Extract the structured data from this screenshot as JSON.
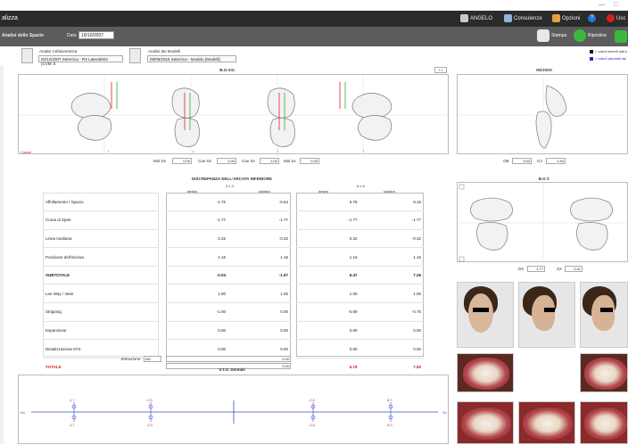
{
  "window": {
    "title": "alizza",
    "min": "—",
    "max": "□"
  },
  "topbar": {
    "user": "ANGELO",
    "consult": "Consulenze",
    "options": "Opzioni",
    "help": "?",
    "exit": "Usc"
  },
  "toolbar": {
    "analysis_label": "Analisi dello Spazio",
    "date_label": "Data",
    "date_value": "19/10/2007",
    "print": "Stampa",
    "reset": "Ripristina"
  },
  "selectors": {
    "ceph_label": "Analisi Cefalometrica",
    "ceph_value": "02/12/2007 Seterrica - RX LateraleDx (CVM: 5",
    "model_label": "Analisi dei Modelli",
    "model_value": "09/05/2016 Seterrica - Modelo (Modelli)"
  },
  "legend": {
    "manual": "= valori inseriti dall'u",
    "computed": "= valori calcolati dal",
    "manual_color": "#111111",
    "computed_color": "#1e2fd0"
  },
  "bovd": {
    "title": "B.O.V.D.",
    "add_btn": "+-+",
    "side_label": "Classe",
    "inputs": [
      {
        "label": "Mol Dx",
        "value": "0.00"
      },
      {
        "label": "Can Dx",
        "value": "2.00"
      },
      {
        "label": "Can Sx",
        "value": "2.00"
      },
      {
        "label": "Mol Sx",
        "value": "0.00"
      }
    ]
  },
  "incisivi": {
    "title": "INCISIVI",
    "ob_label": "OB",
    "ob_value": "3.53",
    "oj_label": "OJ",
    "oj_value": "1.54"
  },
  "bot": {
    "title": "B.O.T.",
    "dx_label": "DX",
    "dx_value": "1.77",
    "sx_label": "SX",
    "sx_value": "0.41"
  },
  "discrepanza": {
    "title": "DISCREPANZA DELL'ARCATA INFERIORE",
    "group1": "3 x 3",
    "group2": "6 x 6",
    "col_dx": "destra",
    "col_sx": "sinistra",
    "rows": [
      {
        "label": "Affollamento / Spazio",
        "a": "-1.75",
        "b": "-0.64",
        "c": "6.76",
        "d": "8.15",
        "style": ""
      },
      {
        "label": "Curva di Spee",
        "a": "-1.77",
        "b": "-1.77",
        "c": "-1.77",
        "d": "-1.77",
        "style": ""
      },
      {
        "label": "Linea mediana",
        "a": "0.32",
        "b": "-0.32",
        "c": "0.32",
        "d": "-0.32",
        "style": ""
      },
      {
        "label": "Posizione dell'incisivo",
        "a": "1.16",
        "b": "1.16",
        "c": "1.16",
        "d": "1.16",
        "style": ""
      },
      {
        "label": "SUBTOTALE",
        "a": "-2.04",
        "b": "-1.57",
        "c": "6.47",
        "d": "7.26",
        "style": "bold"
      },
      {
        "label": "Lee Way / Varie",
        "a": "1.00",
        "b": "1.00",
        "c": "1.00",
        "d": "1.00",
        "style": ""
      },
      {
        "label": "Stripping",
        "a": "-1.00",
        "b": "0.00",
        "c": "-0.69",
        "d": "-0.76",
        "style": ""
      },
      {
        "label": "Espansione",
        "a": "0.00",
        "b": "0.00",
        "c": "0.00",
        "d": "0.00",
        "style": ""
      },
      {
        "label": "Distalizzazione 6TS",
        "a": "0.00",
        "b": "0.00",
        "c": "0.00",
        "d": "0.00",
        "style": ""
      },
      {
        "label": "TOTALE",
        "a": "-2.04",
        "b": "-0.57",
        "c": "6.78",
        "d": "7.50",
        "style": "red"
      }
    ],
    "estrazione_label": "Estrazione",
    "estrazione_value": "NO",
    "bottom_a": "0.00",
    "bottom_b": "0.00"
  },
  "vto": {
    "title": "V.T.O. Dentale",
    "left": "Dx",
    "right": "Sx",
    "marks": [
      {
        "top": "4,7",
        "bottom": "4,7"
      },
      {
        "top": "-2,0",
        "bottom": "-2,0"
      },
      {
        "top": "-0,6",
        "bottom": "-0,6"
      },
      {
        "top": "6,9",
        "bottom": "6,9"
      }
    ]
  }
}
